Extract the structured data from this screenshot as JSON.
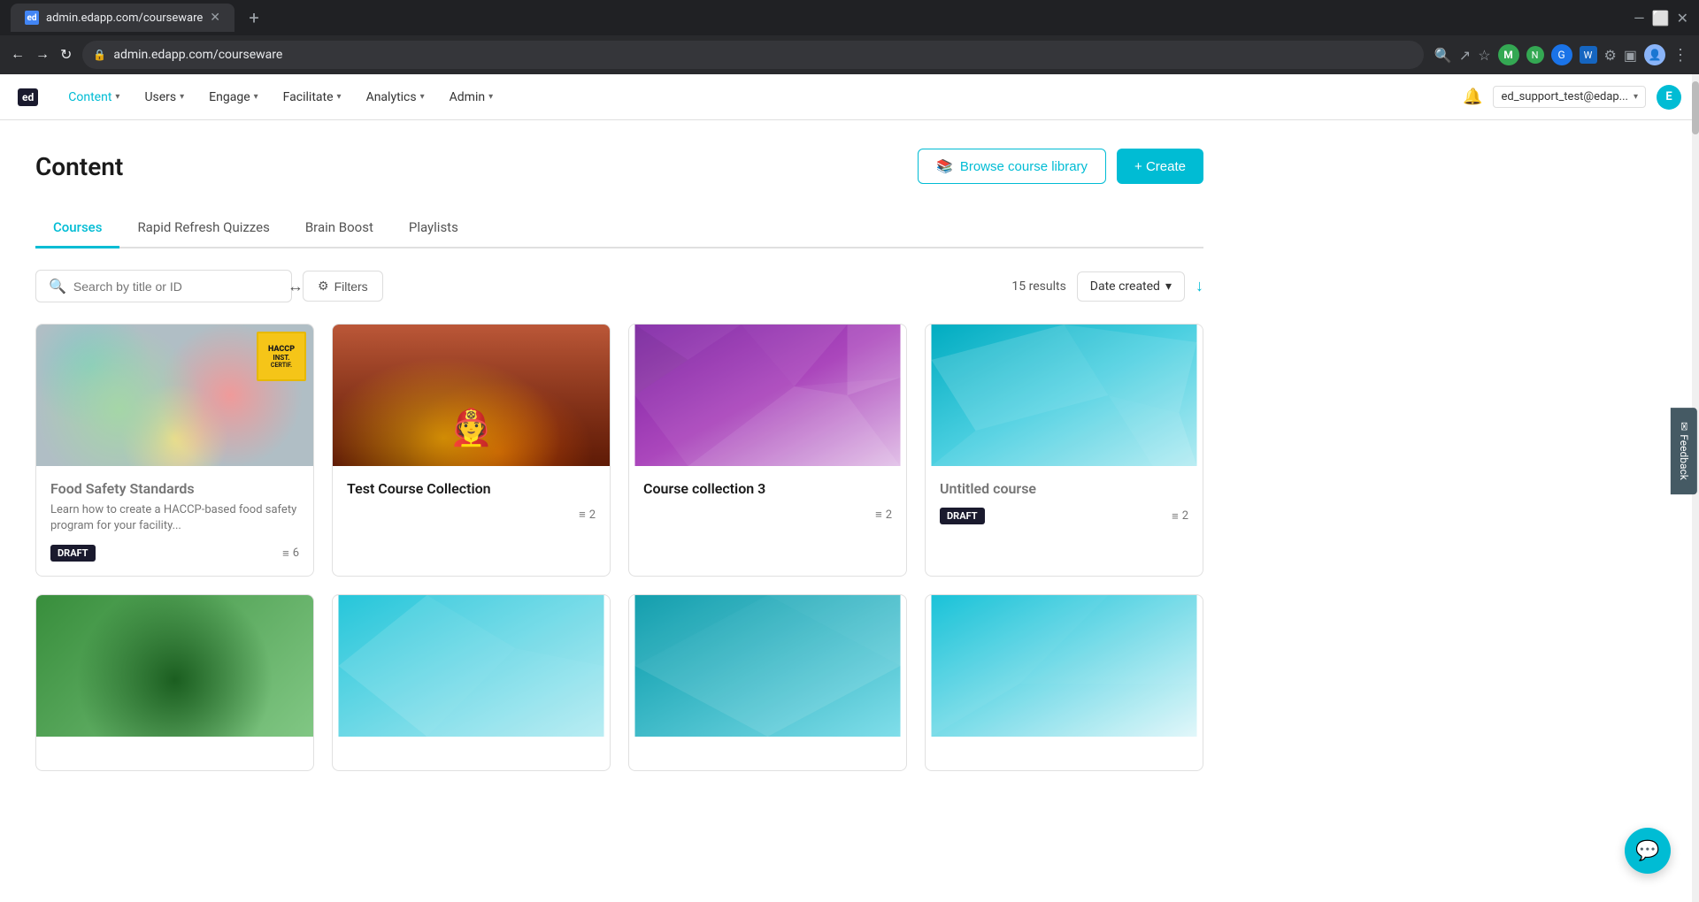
{
  "browser": {
    "tab_label": "ed",
    "url": "admin.edapp.com/courseware",
    "new_tab_icon": "+",
    "back_icon": "←",
    "forward_icon": "→",
    "refresh_icon": "↻"
  },
  "nav": {
    "logo": "ed",
    "items": [
      {
        "label": "Content",
        "has_dropdown": true
      },
      {
        "label": "Users",
        "has_dropdown": true
      },
      {
        "label": "Engage",
        "has_dropdown": true
      },
      {
        "label": "Facilitate",
        "has_dropdown": true
      },
      {
        "label": "Analytics",
        "has_dropdown": true
      },
      {
        "label": "Admin",
        "has_dropdown": true
      }
    ],
    "user_email": "ed_support_test@edap...",
    "user_initial": "E"
  },
  "page": {
    "title": "Content",
    "browse_label": "Browse course library",
    "create_label": "+ Create"
  },
  "tabs": [
    {
      "label": "Courses",
      "active": true
    },
    {
      "label": "Rapid Refresh Quizzes",
      "active": false
    },
    {
      "label": "Brain Boost",
      "active": false
    },
    {
      "label": "Playlists",
      "active": false
    }
  ],
  "toolbar": {
    "search_placeholder": "Search by title or ID",
    "filter_label": "Filters",
    "results_count": "15 results",
    "sort_label": "Date created",
    "sort_arrow": "↓"
  },
  "courses": [
    {
      "id": 1,
      "title": "Food Safety Standards",
      "description": "Learn how to create a HACCP-based food safety program for your facility...",
      "draft": true,
      "lesson_count": 6,
      "img_type": "food"
    },
    {
      "id": 2,
      "title": "Test Course Collection",
      "description": "",
      "draft": false,
      "lesson_count": 2,
      "img_type": "fire"
    },
    {
      "id": 3,
      "title": "Course collection 3",
      "description": "",
      "draft": false,
      "lesson_count": 2,
      "img_type": "purple"
    },
    {
      "id": 4,
      "title": "Untitled course",
      "description": "",
      "draft": true,
      "lesson_count": 2,
      "img_type": "blue"
    }
  ],
  "bottom_row": [
    {
      "id": 5,
      "img_type": "green",
      "title": "",
      "draft": false,
      "lesson_count": 0
    },
    {
      "id": 6,
      "img_type": "blue2",
      "title": "",
      "draft": false,
      "lesson_count": 0
    },
    {
      "id": 7,
      "img_type": "blue3",
      "title": "",
      "draft": false,
      "lesson_count": 0
    },
    {
      "id": 8,
      "img_type": "blue4",
      "title": "",
      "draft": false,
      "lesson_count": 0
    }
  ],
  "feedback": {
    "label": "Feedback"
  },
  "icons": {
    "search": "🔍",
    "filter": "⚙",
    "bell": "🔔",
    "book": "📚",
    "chat": "💬",
    "lessons": "≡",
    "lock": "🔒",
    "star": "★",
    "chevron_down": "▾",
    "chevron_down_sort": "▾"
  }
}
